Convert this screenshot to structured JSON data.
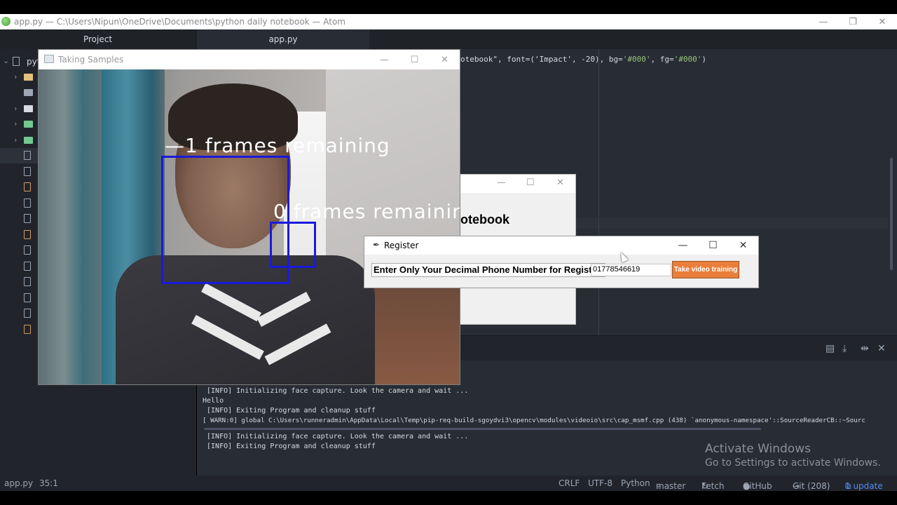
{
  "atom": {
    "window_title": "app.py — C:\\Users\\Nipun\\OneDrive\\Documents\\python daily notebook — Atom",
    "tabs": {
      "project": "Project",
      "file": "app.py"
    },
    "tree_root": "pyt",
    "code_line": [
      "otebook\", font=('Impact', -20), bg=",
      "'#000'",
      ", fg=",
      "'#000'",
      ")"
    ],
    "terminal_lines": [
      " [INFO] Initializing face capture. Look the camera and wait ...",
      "Hello",
      " [INFO] Exiting Program and cleanup stuff",
      "[ WARN:0] global C:\\Users\\runneradmin\\AppData\\Local\\Temp\\pip-req-build-sgoydvi3\\opencv\\modules\\videoio\\src\\cap_msmf.cpp (438) `anonymous-namespace'::SourceReaderCB::~Sourc",
      " [INFO] Initializing face capture. Look the camera and wait ...",
      " [INFO] Exiting Program and cleanup stuff"
    ],
    "status": {
      "file": "app.py",
      "cursor": "35:1",
      "line_ending": "CRLF",
      "encoding": "UTF-8",
      "grammar": "Python",
      "branch": "master",
      "fetch": "Fetch",
      "github": "GitHub",
      "git": "Git (208)",
      "update": "1 update"
    }
  },
  "watermark": {
    "line1": "Activate Windows",
    "line2": "Go to Settings to activate Windows."
  },
  "samples_window": {
    "title": "Taking Samples",
    "overlay_1": "—1 frames remaining",
    "overlay_2": "0 frames remainin"
  },
  "notebook_window": {
    "heading": "otebook"
  },
  "register_window": {
    "title": "Register",
    "label": "Enter Only Your Decimal Phone Number for Register:",
    "phone_value": "01778546619",
    "button": "Take video training"
  },
  "colors": {
    "face_box": "#1a1adb",
    "button": "#e97e3a",
    "editor_bg": "#282c34"
  }
}
